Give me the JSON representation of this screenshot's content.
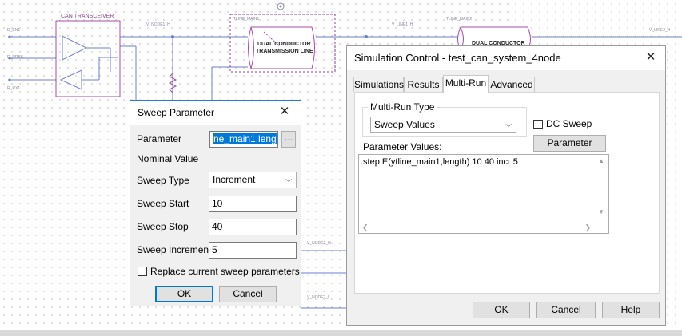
{
  "schematic": {
    "labels": {
      "transceiver_title": "CAN TRANSCEIVER",
      "tline_main": "TLINE_MAIN1",
      "tline_main2": "TLINE_MAIN2",
      "dual_conductor": "DUAL CONDUCTOR",
      "transmission_line": "TRANSMISSION LINE",
      "dual_conductor_2": "DUAL CONDUCTOR",
      "node1": "V_NODE1_H",
      "line1": "V_LINE1_H",
      "line2": "V_LINE2_H",
      "node2h": "V_NODE2_H",
      "node2l": "V_NODE2_L",
      "d_en": "D_EN1",
      "d_prbs": "D_PRBS",
      "r_rx": "R_RX1"
    }
  },
  "sweep_dialog": {
    "title": "Sweep Parameter",
    "close_glyph": "✕",
    "parameter_label": "Parameter",
    "parameter_value": "ne_main1,length",
    "browse_label": "...",
    "nominal_label": "Nominal Value",
    "sweep_type_label": "Sweep Type",
    "sweep_type_value": "Increment",
    "start_label": "Sweep Start",
    "start_value": "10",
    "stop_label": "Sweep Stop",
    "stop_value": "40",
    "increment_label": "Sweep Increment",
    "increment_value": "5",
    "replace_label": "Replace current sweep parameters",
    "replace_checked": false,
    "ok_label": "OK",
    "cancel_label": "Cancel"
  },
  "sim_dialog": {
    "title": "Simulation Control - test_can_system_4node",
    "close_glyph": "✕",
    "tabs": [
      {
        "label": "Simulations",
        "active": false
      },
      {
        "label": "Results",
        "active": false
      },
      {
        "label": "Multi-Run",
        "active": true
      },
      {
        "label": "Advanced",
        "active": false
      }
    ],
    "multirun_group_label": "Multi-Run Type",
    "multirun_type_value": "Sweep Values",
    "dc_sweep_label": "DC Sweep",
    "dc_sweep_checked": false,
    "param_edit_label": "Parameter Edit...",
    "param_values_label": "Parameter Values:",
    "param_values_text": ".step E(ytline_main1,length) 10 40 incr 5",
    "ok_label": "OK",
    "cancel_label": "Cancel",
    "help_label": "Help"
  },
  "colors": {
    "accent": "#0078d7",
    "wire": "#6b7fd1",
    "component": "#a84ca8"
  },
  "icons": {
    "close": "close-icon",
    "dropdown": "chevron-down-icon",
    "scroll_up": "scroll-up-icon",
    "scroll_down": "scroll-down-icon"
  }
}
